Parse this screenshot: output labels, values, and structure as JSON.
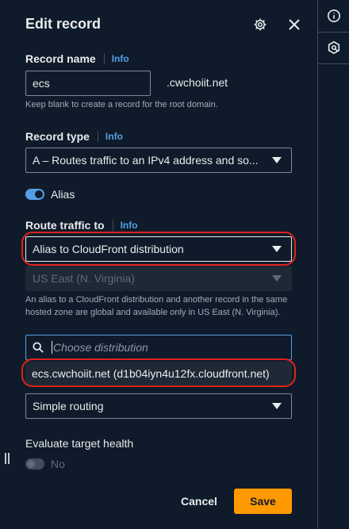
{
  "panel": {
    "title": "Edit record",
    "settings_icon": "gear-icon",
    "close_icon": "close-icon"
  },
  "record_name": {
    "label": "Record name",
    "info": "Info",
    "value": "ecs",
    "suffix": ".cwchoiit.net",
    "hint": "Keep blank to create a record for the root domain."
  },
  "record_type": {
    "label": "Record type",
    "info": "Info",
    "value": "A – Routes traffic to an IPv4 address and so..."
  },
  "alias": {
    "label": "Alias",
    "enabled": true
  },
  "route_traffic": {
    "label": "Route traffic to",
    "info": "Info",
    "endpoint": "Alias to CloudFront distribution",
    "region": "US East (N. Virginia)",
    "hint": "An alias to a CloudFront distribution and another record in the same hosted zone are global and available only in US East (N. Virginia).",
    "search_placeholder": "Choose distribution",
    "suggestion": "ecs.cwchoiit.net (d1b04iyn4u12fx.cloudfront.net)"
  },
  "routing_policy": {
    "value": "Simple routing"
  },
  "health": {
    "label": "Evaluate target health",
    "toggle_label": "No",
    "enabled": false
  },
  "footer": {
    "cancel_label": "Cancel",
    "save_label": "Save"
  },
  "colors": {
    "accent": "#ff9900",
    "link": "#539fe5",
    "toggle_on": "#539fe5",
    "highlight_ring": "#e0221b"
  }
}
